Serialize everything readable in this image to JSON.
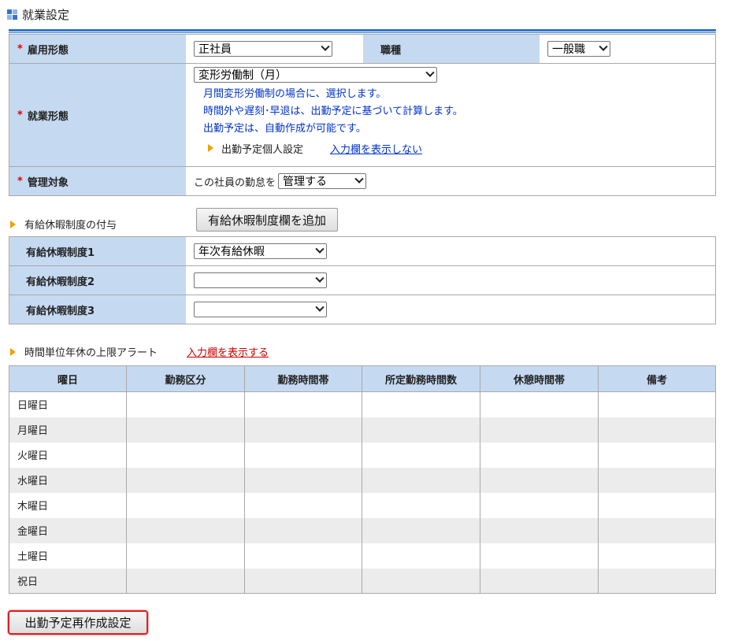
{
  "header": {
    "title": "就業設定",
    "icon": "grid-icon",
    "icon_colors": [
      "#2f74d0",
      "#8fb4e8",
      "#8fb4e8",
      "#2f74d0"
    ]
  },
  "employment": {
    "required_mark": "*",
    "type_label": "雇用形態",
    "type_value": "正社員",
    "job_label": "職種",
    "job_value": "一般職",
    "work_label": "就業形態",
    "work_value": "変形労働制（月）",
    "work_note1": "月間変形労働制の場合に、選択します。",
    "work_note2": "時間外や遅刻･早退は、出勤予定に基づいて計算します。",
    "work_note3": "出勤予定は、自動作成が可能です。",
    "personal_setting_label": "出勤予定個人設定",
    "hide_input_link": "入力欄を表示しない",
    "manage_label": "管理対象",
    "manage_prefix": "この社員の勤怠を",
    "manage_value": "管理する"
  },
  "paid_leave": {
    "heading": "有給休暇制度の付与",
    "add_button": "有給休暇制度欄を追加",
    "rows": [
      {
        "label": "有給休暇制度1",
        "value": "年次有給休暇"
      },
      {
        "label": "有給休暇制度2",
        "value": ""
      },
      {
        "label": "有給休暇制度3",
        "value": ""
      }
    ]
  },
  "hourly_alert": {
    "label": "時間単位年休の上限アラート",
    "show_input_link": "入力欄を表示する"
  },
  "schedule": {
    "headers": [
      "曜日",
      "勤務区分",
      "勤務時間帯",
      "所定勤務時間数",
      "休憩時間帯",
      "備考"
    ],
    "rows": [
      "日曜日",
      "月曜日",
      "火曜日",
      "水曜日",
      "木曜日",
      "金曜日",
      "土曜日",
      "祝日"
    ]
  },
  "footer": {
    "recreate_button": "出勤予定再作成設定",
    "focus_color": "#e02020"
  }
}
